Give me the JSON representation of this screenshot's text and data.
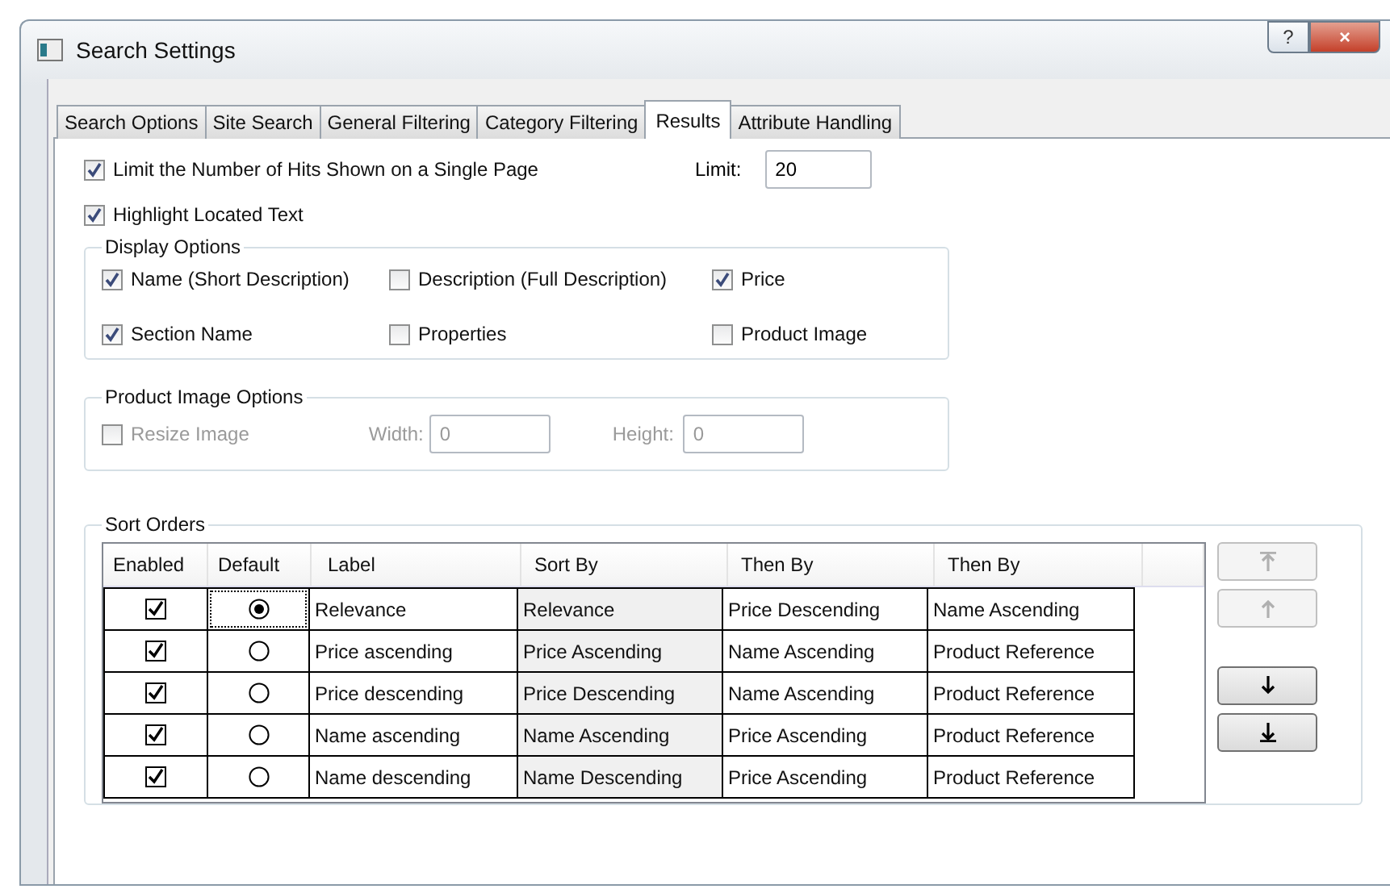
{
  "window": {
    "title": "Search Settings",
    "buttons": [
      "?",
      "×"
    ]
  },
  "tabs": [
    {
      "label": "Search Options",
      "selected": false
    },
    {
      "label": "Site Search",
      "selected": false
    },
    {
      "label": "General Filtering",
      "selected": false
    },
    {
      "label": "Category Filtering",
      "selected": false
    },
    {
      "label": "Results",
      "selected": true
    },
    {
      "label": "Attribute Handling",
      "selected": false
    }
  ],
  "limit_hits": {
    "label": "Limit the Number of Hits Shown on a Single Page",
    "checked": true,
    "limit_label": "Limit:",
    "limit_value": "20"
  },
  "highlight": {
    "label": "Highlight Located Text",
    "checked": true
  },
  "display_options": {
    "title": "Display Options",
    "items": [
      {
        "label": "Name (Short Description)",
        "checked": true
      },
      {
        "label": "Description (Full Description)",
        "checked": false
      },
      {
        "label": "Price",
        "checked": true
      },
      {
        "label": "Section Name",
        "checked": true
      },
      {
        "label": "Properties",
        "checked": false
      },
      {
        "label": "Product Image",
        "checked": false
      }
    ]
  },
  "image_options": {
    "title": "Product Image Options",
    "resize": {
      "label": "Resize Image",
      "checked": false,
      "disabled": true
    },
    "width_label": "Width:",
    "width_value": "0",
    "height_label": "Height:",
    "height_value": "0"
  },
  "sort_orders": {
    "title": "Sort Orders",
    "columns": [
      "Enabled",
      "Default",
      "Label",
      "Sort By",
      "Then By",
      "Then By"
    ],
    "rows": [
      {
        "enabled": true,
        "selected": true,
        "label": "Relevance",
        "sort_by": "Relevance",
        "then_by_1": "Price Descending",
        "then_by_2": "Name Ascending"
      },
      {
        "enabled": true,
        "selected": false,
        "label": "Price ascending",
        "sort_by": "Price Ascending",
        "then_by_1": "Name Ascending",
        "then_by_2": "Product Reference"
      },
      {
        "enabled": true,
        "selected": false,
        "label": "Price descending",
        "sort_by": "Price Descending",
        "then_by_1": "Name Ascending",
        "then_by_2": "Product Reference"
      },
      {
        "enabled": true,
        "selected": false,
        "label": "Name ascending",
        "sort_by": "Name Ascending",
        "then_by_1": "Price Ascending",
        "then_by_2": "Product Reference"
      },
      {
        "enabled": true,
        "selected": false,
        "label": "Name descending",
        "sort_by": "Name Descending",
        "then_by_1": "Price Ascending",
        "then_by_2": "Product Reference"
      }
    ],
    "move_buttons": [
      {
        "kind": "top",
        "disabled": true
      },
      {
        "kind": "up",
        "disabled": true
      },
      {
        "kind": "down",
        "disabled": false
      },
      {
        "kind": "bottom",
        "disabled": false
      }
    ]
  }
}
